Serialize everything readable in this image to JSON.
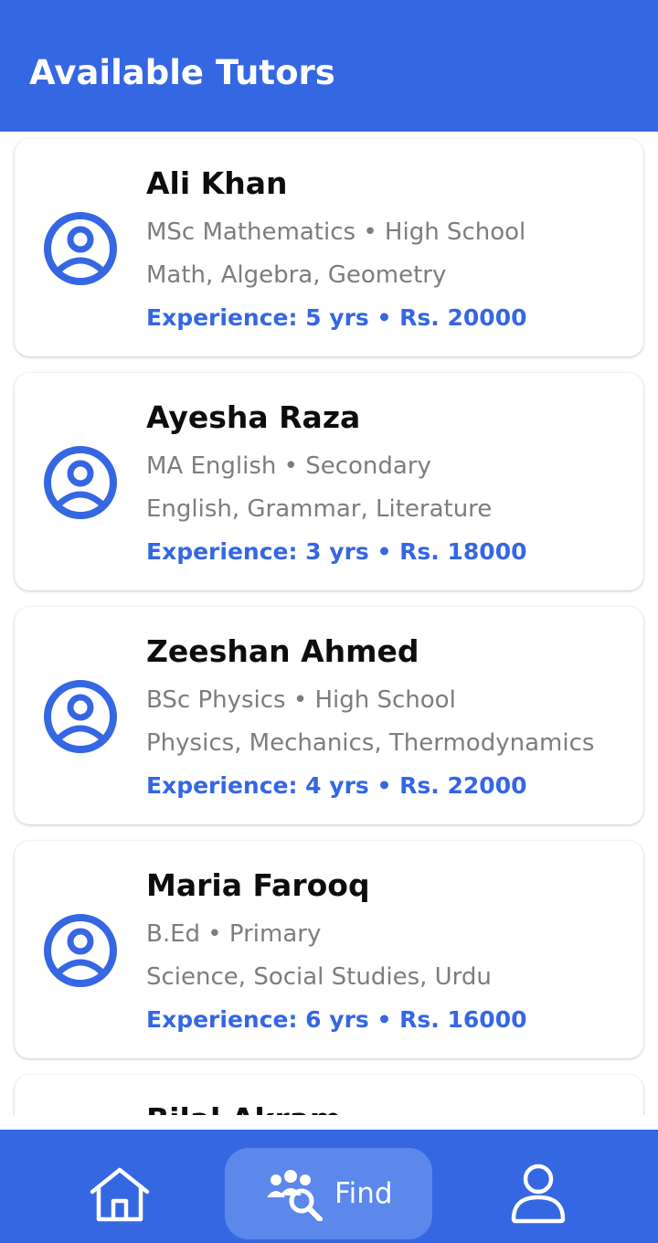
{
  "header": {
    "title": "Available Tutors"
  },
  "tutors": [
    {
      "name": "Ali Khan",
      "qualification": "MSc Mathematics • High School",
      "subjects": "Math, Algebra, Geometry",
      "experience": "Experience: 5 yrs • Rs. 20000"
    },
    {
      "name": "Ayesha Raza",
      "qualification": "MA English • Secondary",
      "subjects": "English, Grammar, Literature",
      "experience": "Experience: 3 yrs • Rs. 18000"
    },
    {
      "name": "Zeeshan Ahmed",
      "qualification": "BSc Physics • High School",
      "subjects": "Physics, Mechanics, Thermodynamics",
      "experience": "Experience: 4 yrs • Rs. 22000"
    },
    {
      "name": "Maria Farooq",
      "qualification": "B.Ed • Primary",
      "subjects": "Science, Social Studies, Urdu",
      "experience": "Experience: 6 yrs • Rs. 16000"
    },
    {
      "name": "Bilal Akram"
    }
  ],
  "nav": {
    "items": [
      {
        "icon": "home-icon"
      },
      {
        "icon": "find-tutors-icon",
        "label": "Find",
        "active": true
      },
      {
        "icon": "profile-icon"
      }
    ]
  },
  "colors": {
    "primary": "#3567e3",
    "active_pill": "#5c88ec",
    "muted_text": "#7d7d7d"
  }
}
